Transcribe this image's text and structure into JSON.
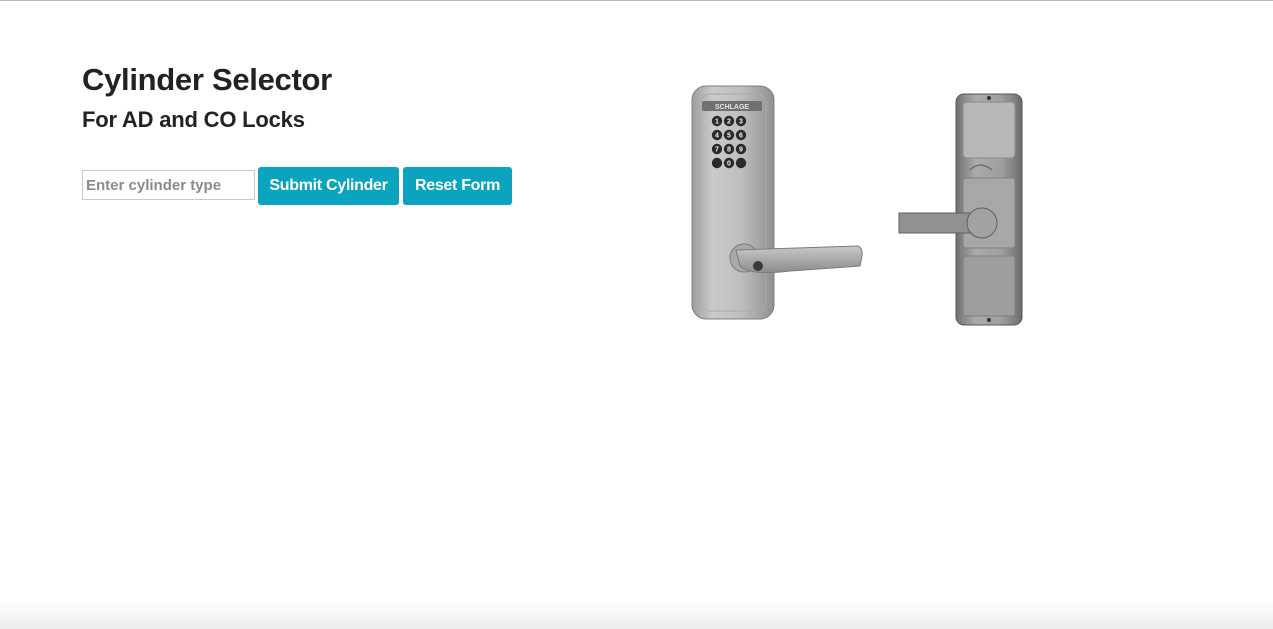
{
  "header": {
    "title": "Cylinder Selector",
    "subtitle": "For AD and CO Locks"
  },
  "form": {
    "cylinder_input": {
      "value": "",
      "placeholder": "Enter cylinder type"
    },
    "submit_label": "Submit Cylinder",
    "reset_label": "Reset Form"
  },
  "product_image": {
    "brand_plate": "SCHLAGE",
    "keypad_keys": [
      "1",
      "2",
      "3",
      "4",
      "5",
      "6",
      "7",
      "8",
      "9",
      "0"
    ]
  },
  "colors": {
    "accent": "#0aa4bf",
    "text": "#222222",
    "background": "#ffffff"
  }
}
